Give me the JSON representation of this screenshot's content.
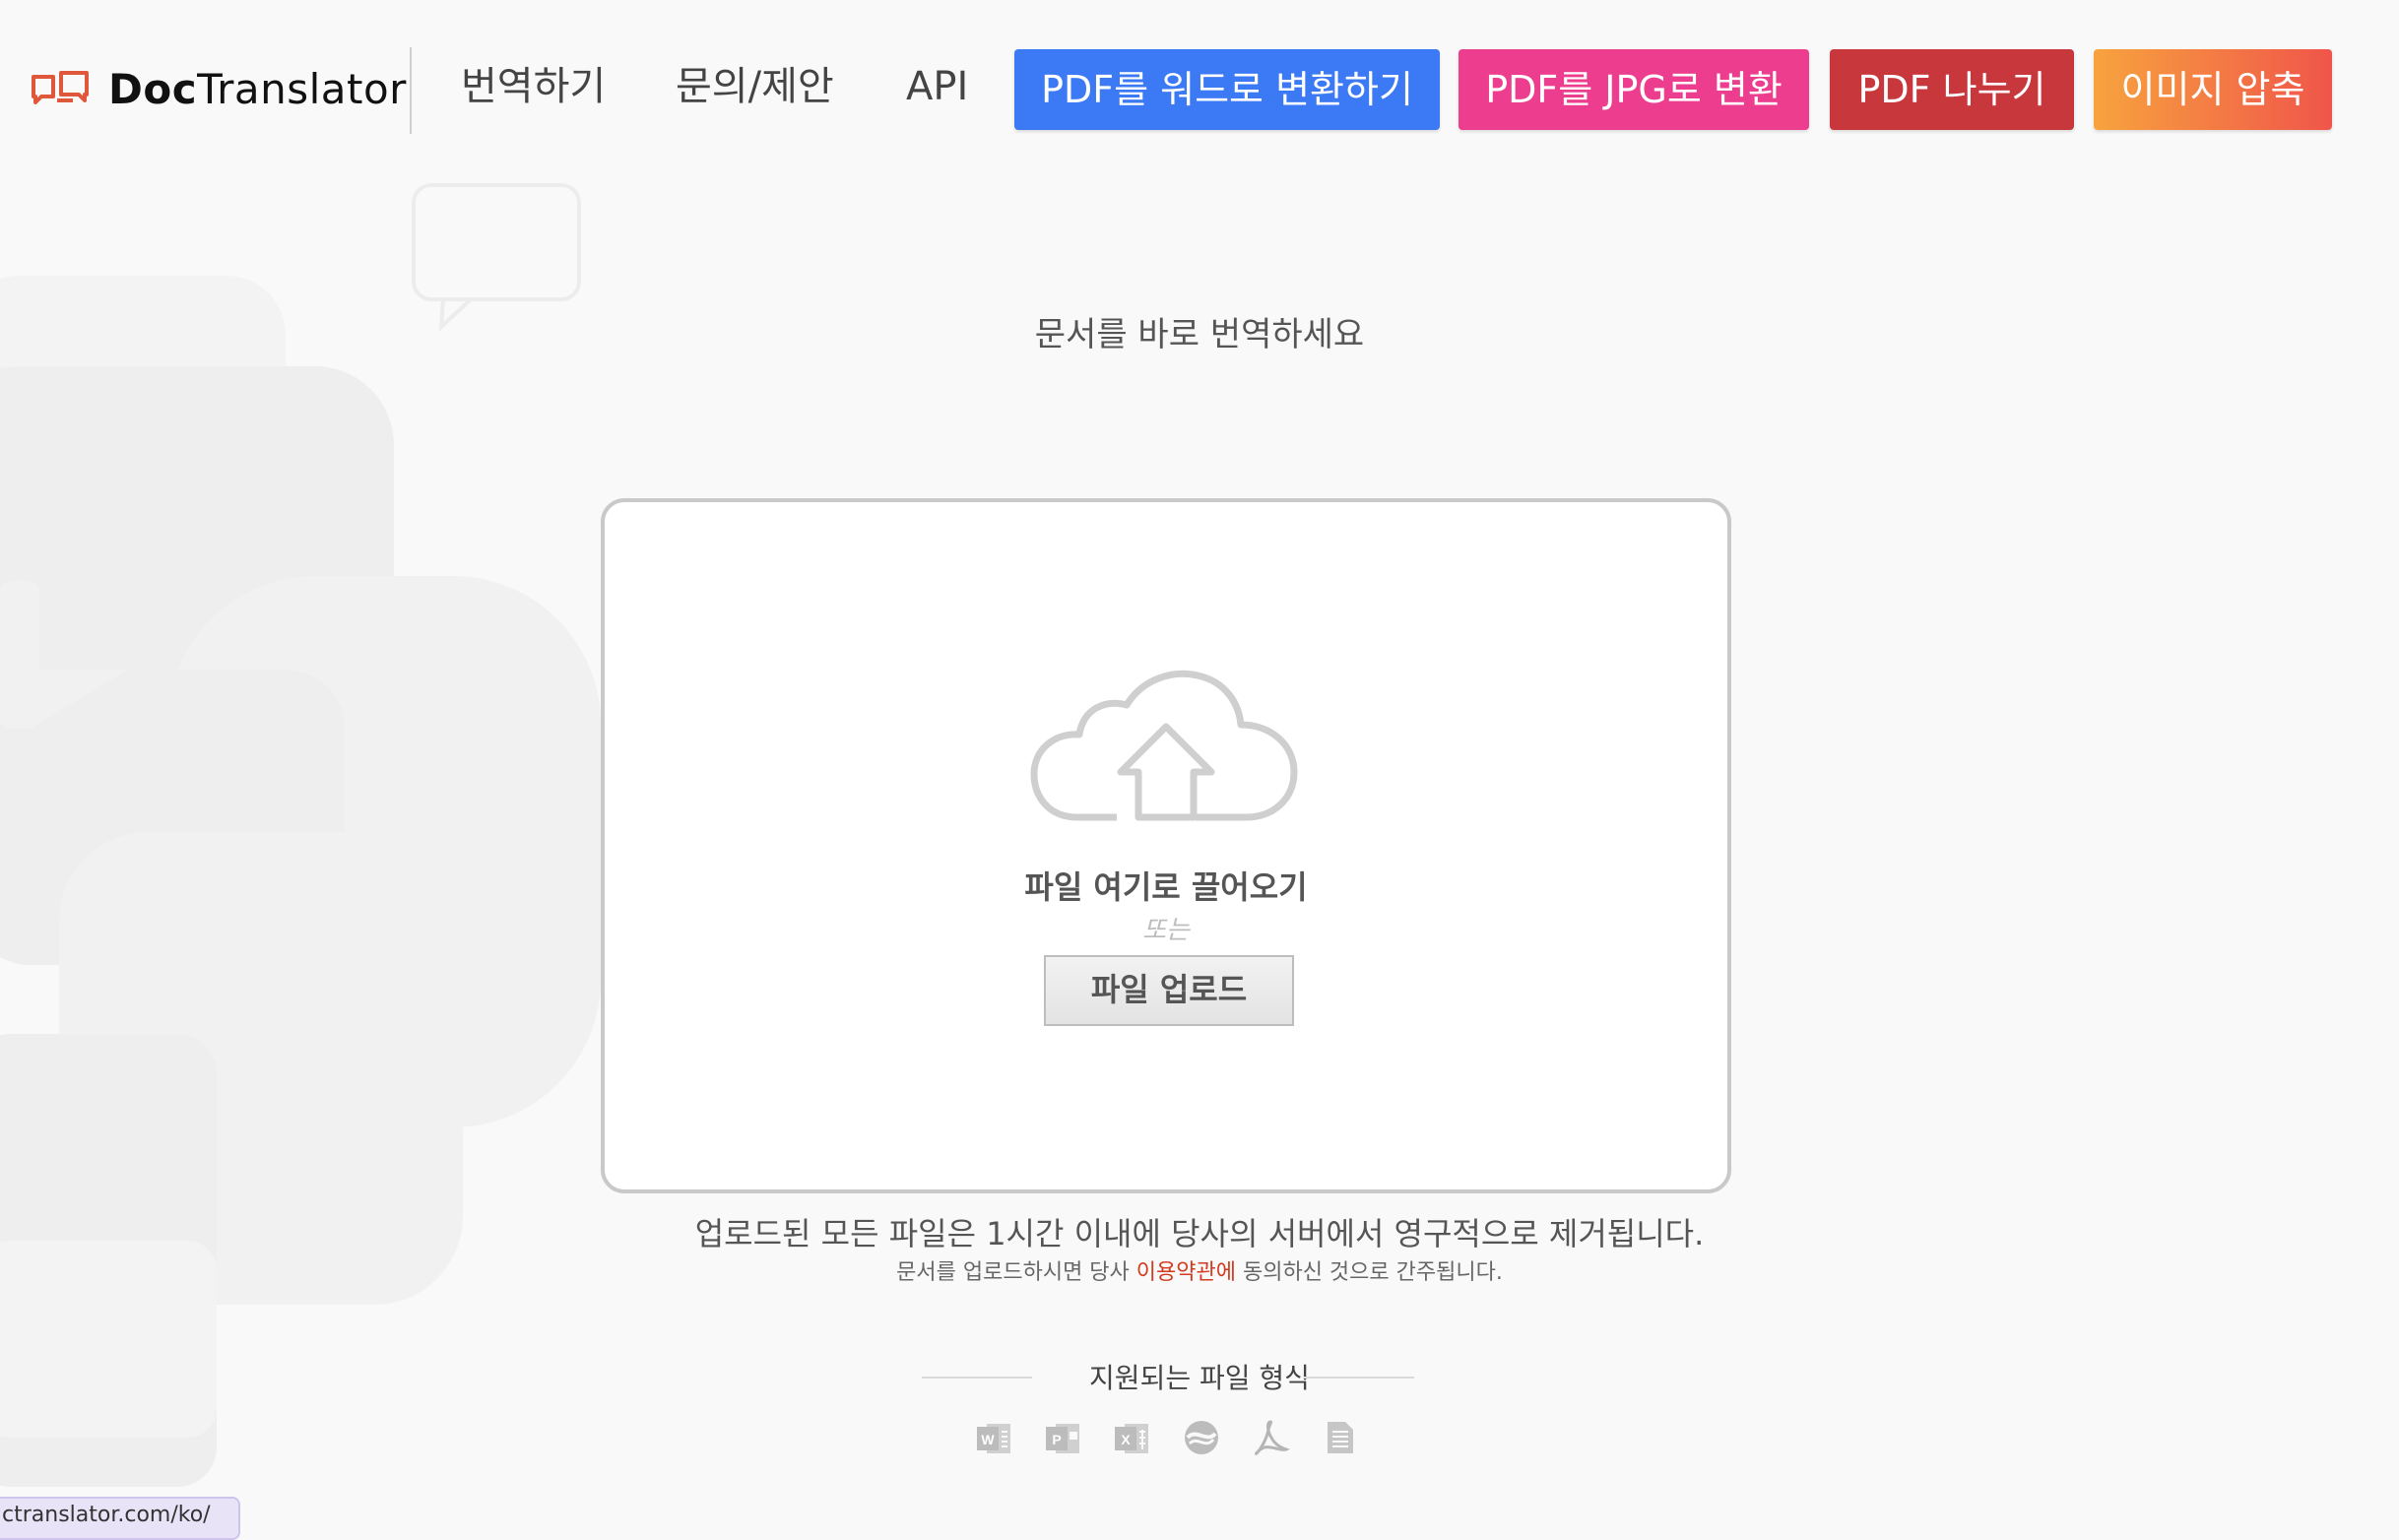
{
  "header": {
    "logo_text_bold": "Doc",
    "logo_text_rest": "Translator",
    "nav": {
      "translate": "번역하기",
      "contact": "문의/제안",
      "api": "API"
    },
    "buttons": {
      "pdf_to_word": "PDF를 워드로 변환하기",
      "pdf_to_jpg": "PDF를 JPG로 변환",
      "split_pdf": "PDF 나누기",
      "compress_image": "이미지 압축"
    },
    "colors": {
      "pdf_to_word": "#3b79f5",
      "pdf_to_jpg": "#ec3d8e",
      "split_pdf": "#c8373c",
      "compress_image_from": "#f7a33e",
      "compress_image_to": "#f0554a",
      "logo": "#e0583c"
    }
  },
  "main": {
    "headline": "문서를 바로 번역하세요",
    "dropzone": {
      "title": "파일 여기로 끌어오기",
      "or": "또는",
      "upload_button": "파일 업로드"
    },
    "notice_line1": "업로드된 모든 파일은 1시간 이내에 당사의 서버에서 영구적으로 제거됩니다.",
    "notice_line2_pre": "문서를 업로드하시면 당사 ",
    "notice_line2_link": "이용약관에",
    "notice_line2_post": " 동의하신 것으로 간주됩니다.",
    "supported_formats_label": "지원되는 파일 형식",
    "format_icons": [
      "word-icon",
      "powerpoint-icon",
      "excel-icon",
      "opendocument-icon",
      "pdf-icon",
      "text-file-icon"
    ]
  },
  "status_url": "ctranslator.com/ko/"
}
